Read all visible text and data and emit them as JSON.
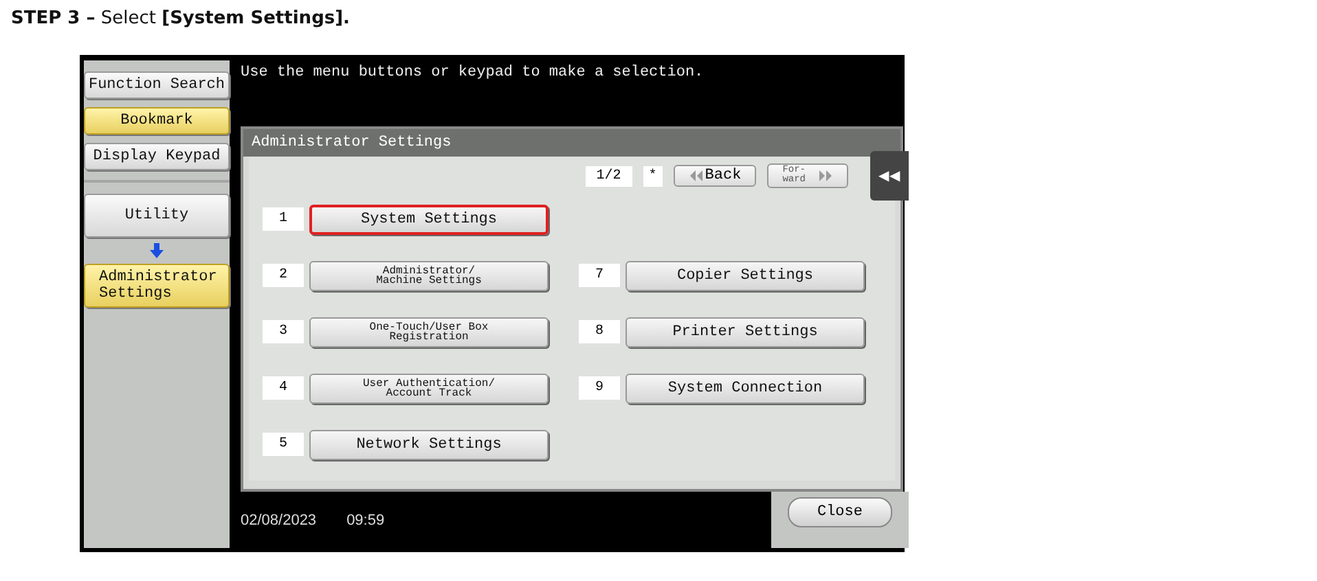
{
  "heading": {
    "step": "STEP 3 –",
    "text": "Select",
    "target": "[System Settings]."
  },
  "panel": {
    "sidebar": [
      {
        "label": "Function Search",
        "selected": false,
        "kind": "button"
      },
      {
        "label": "Bookmark",
        "selected": true,
        "kind": "button"
      },
      {
        "label": "Display Keypad",
        "selected": false,
        "kind": "button"
      },
      {
        "label": "Utility",
        "selected": false,
        "kind": "nav"
      },
      {
        "label": "Administrator Settings",
        "selected": true,
        "kind": "nav"
      }
    ],
    "message": "Use the menu buttons or keypad to make a selection.",
    "title": "Administrator Settings",
    "page": "1/2",
    "star": "*",
    "back": "Back",
    "forward": "For-\nward",
    "collapse": "◀◀",
    "left_items": [
      {
        "number": "1",
        "lines": [
          "System Settings"
        ],
        "highlighted": true
      },
      {
        "number": "2",
        "lines": [
          "Administrator/",
          "Machine Settings"
        ],
        "highlighted": false
      },
      {
        "number": "3",
        "lines": [
          "One-Touch/User Box",
          "Registration"
        ],
        "highlighted": false
      },
      {
        "number": "4",
        "lines": [
          "User Authentication/",
          "Account Track"
        ],
        "highlighted": false
      },
      {
        "number": "5",
        "lines": [
          "Network Settings"
        ],
        "highlighted": false
      }
    ],
    "right_items": [
      {
        "number": "7",
        "lines": [
          "Copier Settings"
        ],
        "highlighted": false
      },
      {
        "number": "8",
        "lines": [
          "Printer Settings"
        ],
        "highlighted": false
      },
      {
        "number": "9",
        "lines": [
          "System Connection"
        ],
        "highlighted": false
      }
    ],
    "date": "02/08/2023",
    "time": "09:59",
    "close": "Close"
  }
}
